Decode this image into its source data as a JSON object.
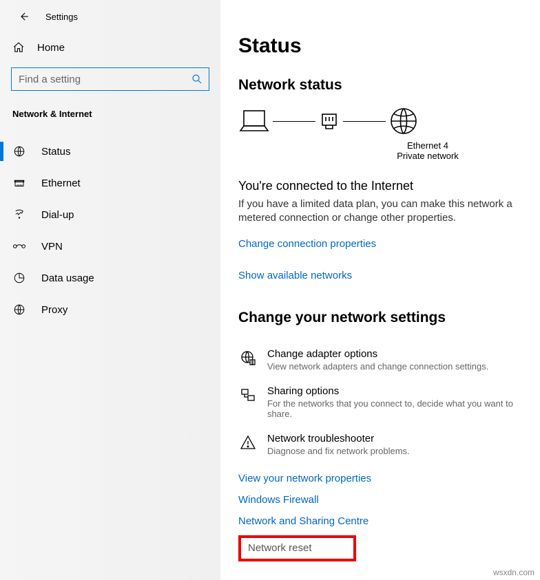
{
  "topbar": {
    "title": "Settings"
  },
  "sidebar": {
    "home_label": "Home",
    "search_placeholder": "Find a setting",
    "group_title": "Network & Internet",
    "items": [
      {
        "label": "Status"
      },
      {
        "label": "Ethernet"
      },
      {
        "label": "Dial-up"
      },
      {
        "label": "VPN"
      },
      {
        "label": "Data usage"
      },
      {
        "label": "Proxy"
      }
    ]
  },
  "main": {
    "page_title": "Status",
    "section1_title": "Network status",
    "diagram": {
      "adapter": "Ethernet 4",
      "network_type": "Private network"
    },
    "connected_title": "You're connected to the Internet",
    "connected_desc": "If you have a limited data plan, you can make this network a metered connection or change other properties.",
    "link_change_props": "Change connection properties",
    "link_show_networks": "Show available networks",
    "section2_title": "Change your network settings",
    "settings": [
      {
        "title": "Change adapter options",
        "desc": "View network adapters and change connection settings."
      },
      {
        "title": "Sharing options",
        "desc": "For the networks that you connect to, decide what you want to share."
      },
      {
        "title": "Network troubleshooter",
        "desc": "Diagnose and fix network problems."
      }
    ],
    "link_view_props": "View your network properties",
    "link_firewall": "Windows Firewall",
    "link_sharing_centre": "Network and Sharing Centre",
    "link_network_reset": "Network reset"
  },
  "watermark": "wsxdn.com"
}
